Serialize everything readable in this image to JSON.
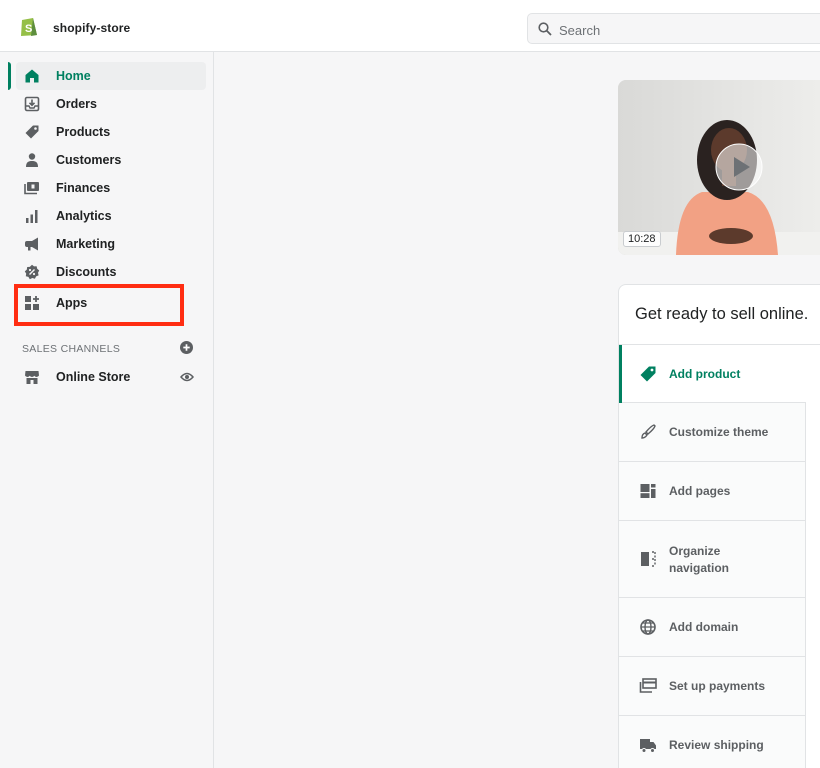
{
  "colors": {
    "accent": "#008060",
    "highlight": "#ff2d12"
  },
  "topbar": {
    "store_name": "shopify-store",
    "search_placeholder": "Search"
  },
  "sidebar": {
    "items": [
      {
        "label": "Home",
        "icon": "home-icon"
      },
      {
        "label": "Orders",
        "icon": "orders-icon"
      },
      {
        "label": "Products",
        "icon": "tag-icon"
      },
      {
        "label": "Customers",
        "icon": "person-icon"
      },
      {
        "label": "Finances",
        "icon": "finances-icon"
      },
      {
        "label": "Analytics",
        "icon": "bar-chart-icon"
      },
      {
        "label": "Marketing",
        "icon": "megaphone-icon"
      },
      {
        "label": "Discounts",
        "icon": "discount-icon"
      },
      {
        "label": "Apps",
        "icon": "apps-icon"
      }
    ],
    "active_item": "Home",
    "sales_channels": {
      "title": "SALES CHANNELS",
      "items": [
        {
          "label": "Online Store",
          "icon": "store-icon"
        }
      ]
    }
  },
  "main": {
    "video": {
      "duration": "10:28"
    },
    "setup_card": {
      "title": "Get ready to sell online.",
      "tasks": [
        {
          "label": "Add product",
          "icon": "tag-icon"
        },
        {
          "label": "Customize theme",
          "icon": "brush-icon"
        },
        {
          "label": "Add pages",
          "icon": "pages-icon"
        },
        {
          "label": "Organize navigation",
          "icon": "navigation-icon"
        },
        {
          "label": "Add domain",
          "icon": "globe-icon"
        },
        {
          "label": "Set up payments",
          "icon": "payments-icon"
        },
        {
          "label": "Review shipping",
          "icon": "truck-icon"
        }
      ]
    }
  }
}
